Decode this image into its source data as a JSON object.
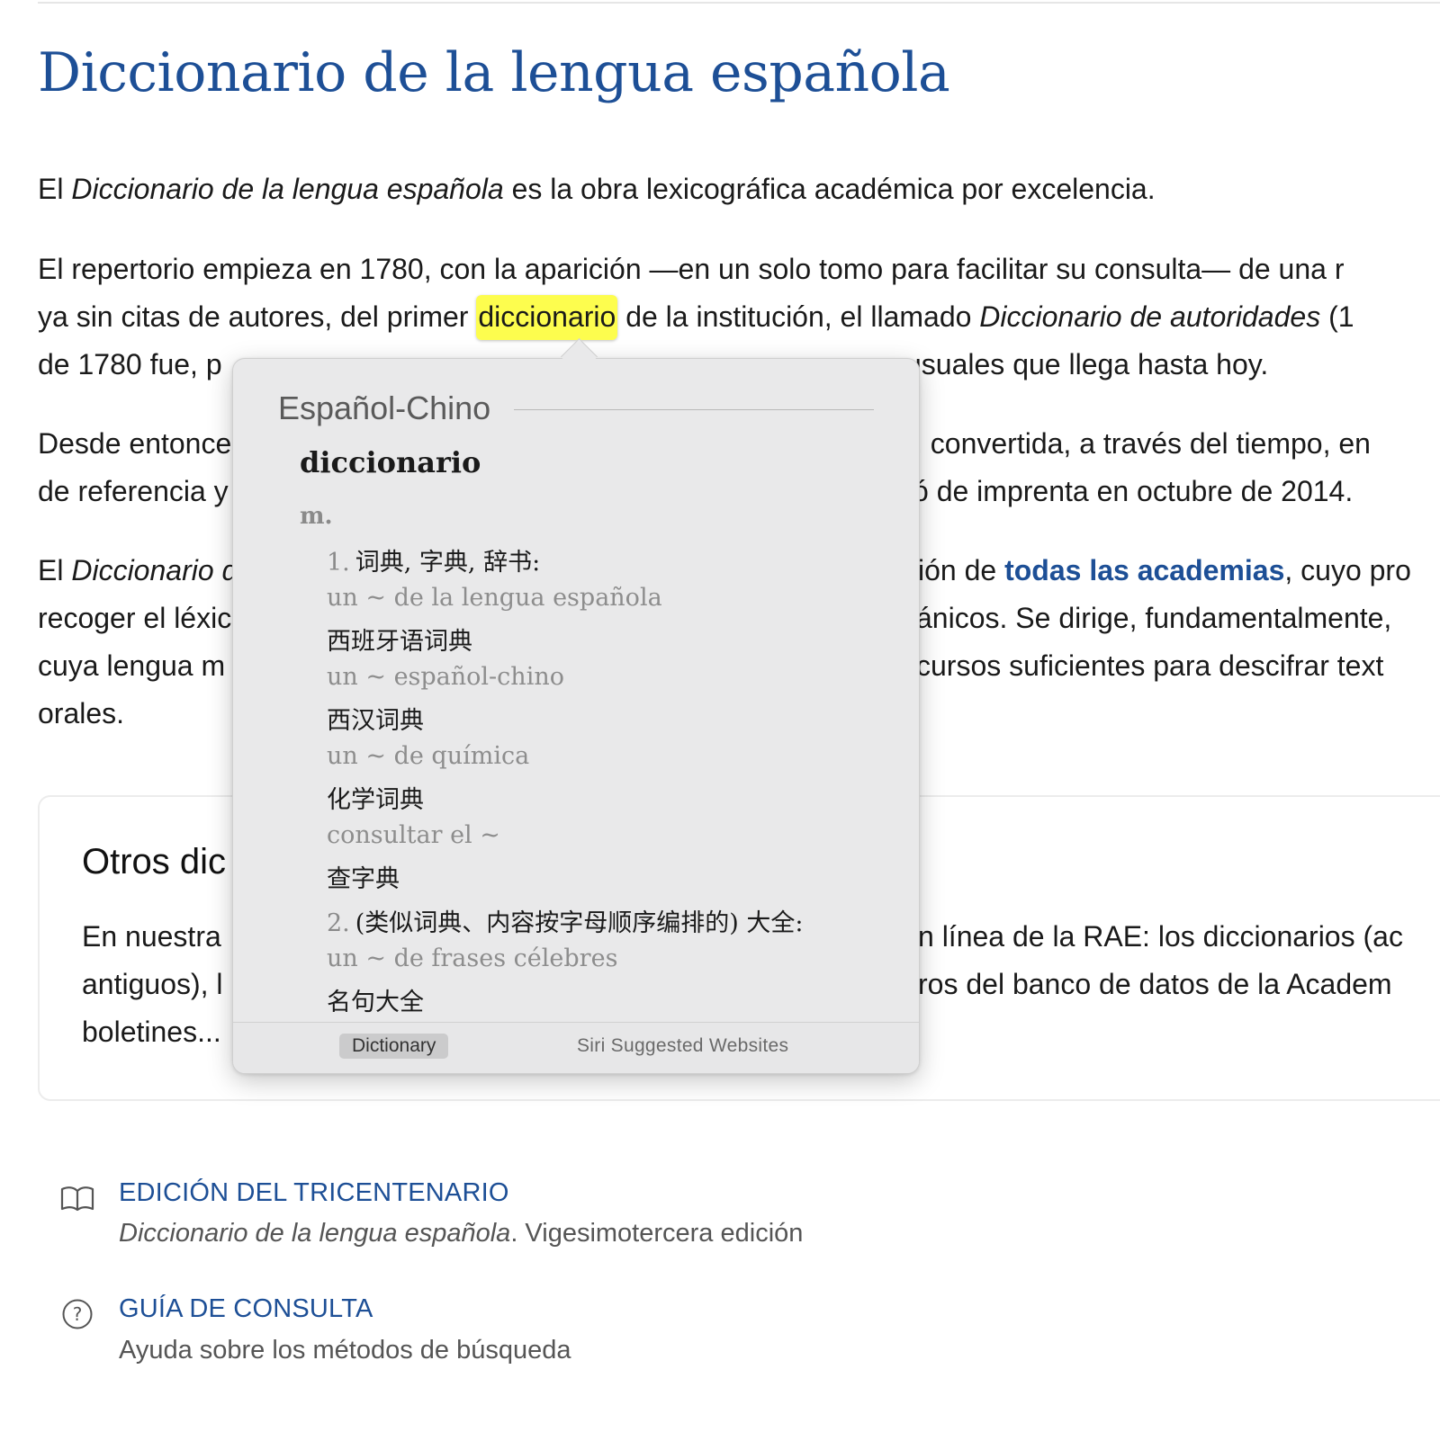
{
  "page": {
    "title": "Diccionario de la lengua española",
    "intro": {
      "p1_a": "El ",
      "p1_b": "Diccionario de la lengua española",
      "p1_c": " es la obra lexicográfica académica por excelencia."
    },
    "p2": {
      "line1": "El repertorio empieza en 1780, con la aparición —en un solo tomo para facilitar su consulta— de una r",
      "line2_a": "ya sin citas de autores, del primer ",
      "line2_highlight": "diccionario",
      "line2_b": " de la institución, el llamado ",
      "line2_i": "Diccionario de autoridades",
      "line2_c": " (1",
      "line3_a": "de 1780 fue, p",
      "line3_b": "usuales que llega hasta hoy."
    },
    "p3": {
      "line1_a": "Desde entonce",
      "line1_b": ", convertida, a través del tiempo, en",
      "line2_a": "de referencia y",
      "line2_b": "ó de imprenta en octubre de 2014."
    },
    "p4": {
      "line1_a": "El ",
      "line1_i": "Diccionario d",
      "line1_b": "ión de ",
      "line1_link": "todas las academias",
      "line1_c": ", cuyo pro",
      "line2_a": "recoger el léxic",
      "line2_b": "ánicos. Se dirige, fundamentalmente,",
      "line3_a": "cuya lengua m",
      "line3_b": "cursos suficientes para descifrar text",
      "line4": "orales."
    },
    "card": {
      "title": "Otros dic",
      "line1_a": "En nuestra",
      "line1_b": "n línea de la RAE: los diccionarios (ac",
      "line2_a": "antiguos), l",
      "line2_b": "ros del banco de datos de la Academ",
      "line3": "boletines..."
    },
    "resources": [
      {
        "title": "EDICIÓN DEL TRICENTENARIO",
        "desc_i": "Diccionario de la lengua española",
        "desc": ". Vigesimotercera edición",
        "icon": "book-icon"
      },
      {
        "title": "GUÍA DE CONSULTA",
        "desc_i": "",
        "desc": "Ayuda sobre los métodos de búsqueda",
        "icon": "help-circle-icon"
      }
    ]
  },
  "popover": {
    "dictionary_name": "Español-Chino",
    "headword": "diccionario",
    "pos": "m.",
    "senses": [
      {
        "num": "1.",
        "definition": "词典, 字典, 辞书:"
      },
      {
        "num": "2.",
        "definition": "(类似词典、内容按字母顺序编排的) 大全:"
      }
    ],
    "examples": [
      {
        "es": "un ~ de la lengua española",
        "zh": "西班牙语词典"
      },
      {
        "es": "un ~ español-chino",
        "zh": "西汉词典"
      },
      {
        "es": "un ~ de química",
        "zh": "化学词典"
      },
      {
        "es": "consultar el ~",
        "zh": "查字典"
      },
      {
        "es": "un ~ de frases célebres",
        "zh": "名句大全"
      }
    ],
    "tabs": {
      "dictionary": "Dictionary",
      "siri": "Siri Suggested Websites",
      "selected": "Dictionary"
    }
  },
  "colors": {
    "title_blue": "#1d4f96",
    "highlight_yellow": "#fdfd4e",
    "popover_bg": "#e9e9ea"
  }
}
